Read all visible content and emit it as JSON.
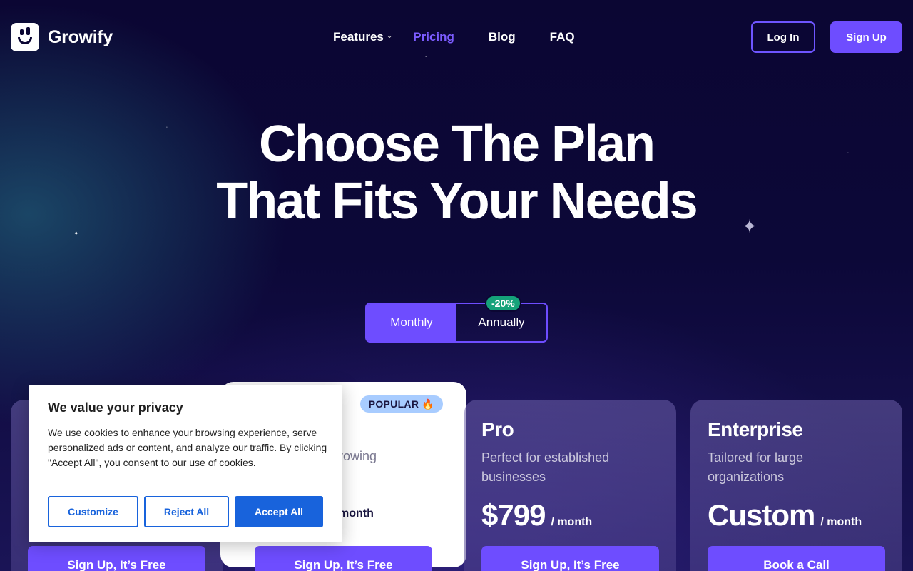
{
  "brand": {
    "name": "Growify"
  },
  "nav": {
    "items": [
      {
        "label": "Features",
        "has_dropdown": true,
        "active": false
      },
      {
        "label": "Pricing",
        "active": true
      },
      {
        "label": "Blog",
        "active": false
      },
      {
        "label": "FAQ",
        "active": false
      }
    ],
    "login_label": "Log In",
    "signup_label": "Sign Up"
  },
  "hero": {
    "line1": "Choose The Plan",
    "line2": "That Fits Your Needs"
  },
  "billing_toggle": {
    "monthly_label": "Monthly",
    "annually_label": "Annually",
    "discount_badge": "-20%",
    "selected": "Monthly"
  },
  "plans": [
    {
      "button_label": "Sign Up, It’s Free"
    },
    {
      "badge": "POPULAR",
      "badge_icon": "fire-icon",
      "partial_desc": "rowing",
      "partial_per": "month",
      "button_label": "Sign Up, It’s Free"
    },
    {
      "title": "Pro",
      "desc": "Perfect for established businesses",
      "price": "$799",
      "per": "/ month",
      "button_label": "Sign Up, It’s Free"
    },
    {
      "title": "Enterprise",
      "desc": "Tailored for large organizations",
      "price": "Custom",
      "per": "/ month",
      "button_label": "Book a Call"
    }
  ],
  "cookie_banner": {
    "title": "We value your privacy",
    "text": "We use cookies to enhance your browsing experience, serve personalized ads or content, and analyze our traffic. By clicking \"Accept All\", you consent to our use of cookies.",
    "customize_label": "Customize",
    "reject_label": "Reject All",
    "accept_label": "Accept All"
  },
  "colors": {
    "accent": "#6e4dff",
    "background": "#0b0633",
    "discount_green": "#15a27a",
    "popular_badge": "#a8ccff",
    "cookie_blue": "#1863dc"
  }
}
